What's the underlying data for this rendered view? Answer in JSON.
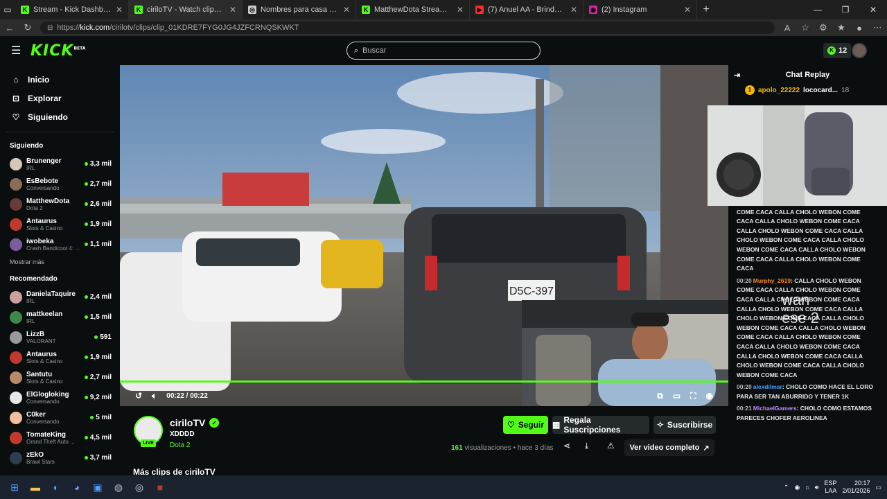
{
  "browser": {
    "tabs": [
      {
        "title": "Stream - Kick Dashboard",
        "favicon_color": "#53fc18",
        "favicon": "K",
        "active": false
      },
      {
        "title": "ciriloTV - Watch clips on Kick",
        "favicon_color": "#53fc18",
        "favicon": "K",
        "active": true
      },
      {
        "title": "Nombres para casa de streamers",
        "favicon_color": "#cfcfcf",
        "favicon": "◎",
        "active": false
      },
      {
        "title": "MatthewDota Stream - Watch Live",
        "favicon_color": "#53fc18",
        "favicon": "K",
        "active": false
      },
      {
        "title": "(7) Anuel AA - Brindemos feat. Oz",
        "favicon_color": "#ff2a2a",
        "favicon": "▶",
        "active": false
      },
      {
        "title": "(2) Instagram",
        "favicon_color": "#d6249f",
        "favicon": "◉",
        "active": false
      }
    ],
    "new_tab": "+",
    "url_domain": "kick.com",
    "url_prefix": "https://",
    "url_path": "/cirilotv/clips/clip_01KDRE7FYG0JG4JZFCRNQSKWKT"
  },
  "header": {
    "logo": "KICK",
    "logo_tag": "BETA",
    "search_placeholder": "Buscar",
    "kicks_count": "12"
  },
  "sidebar": {
    "nav": [
      {
        "label": "Inicio",
        "icon": "home-icon",
        "glyph": "⌂"
      },
      {
        "label": "Explorar",
        "icon": "compass-icon",
        "glyph": "⊡"
      },
      {
        "label": "Siguiendo",
        "icon": "heart-icon",
        "glyph": "♡"
      }
    ],
    "following_title": "Siguiendo",
    "following": [
      {
        "name": "Brunenger",
        "category": "IRL",
        "viewers": "3,3 mil",
        "color": "#d7c7b8"
      },
      {
        "name": "EsBebote",
        "category": "Conversando",
        "viewers": "2,7 mil",
        "color": "#8a6d55"
      },
      {
        "name": "MatthewDota",
        "category": "Dota 2",
        "viewers": "2,6 mil",
        "color": "#6b3b3b"
      },
      {
        "name": "Antaurus",
        "category": "Slots & Casino",
        "viewers": "1,9 mil",
        "color": "#c0392b"
      },
      {
        "name": "iwobeka",
        "category": "Crash Bandicoot 4: ...",
        "viewers": "1,1 mil",
        "color": "#7a5fa0"
      }
    ],
    "show_more": "Mostrar más",
    "recommended_title": "Recomendado",
    "recommended": [
      {
        "name": "DanielaTaquire",
        "category": "IRL",
        "viewers": "2,4 mil",
        "color": "#caa0a0"
      },
      {
        "name": "mattkeelan",
        "category": "IRL",
        "viewers": "1,5 mil",
        "color": "#3c8a4a"
      },
      {
        "name": "LizzB",
        "category": "VALORANT",
        "viewers": "591",
        "color": "#9a9a9a"
      },
      {
        "name": "Antaurus",
        "category": "Slots & Casino",
        "viewers": "1,9 mil",
        "color": "#c0392b"
      },
      {
        "name": "Santutu",
        "category": "Slots & Casino",
        "viewers": "2,7 mil",
        "color": "#b88a6a"
      },
      {
        "name": "ElGlogloking",
        "category": "Conversando",
        "viewers": "9,2 mil",
        "color": "#e8e8e8"
      },
      {
        "name": "C0ker",
        "category": "Conversando",
        "viewers": "5 mil",
        "color": "#f0c0a0"
      },
      {
        "name": "TomateKing",
        "category": "Grand Theft Auto ...",
        "viewers": "4,5 mil",
        "color": "#c0392b"
      },
      {
        "name": "zEkO",
        "category": "Brawl Stars",
        "viewers": "3,7 mil",
        "color": "#2c3e50"
      }
    ]
  },
  "player": {
    "time_current": "00:22",
    "time_sep": "/",
    "time_total": "00:22",
    "progress": 1.0,
    "overlay_line1": "wan",
    "overlay_line2": "ese 2"
  },
  "clip": {
    "channel": "ciriloTV",
    "live": "LIVE",
    "title": "XDDDD",
    "category": "Dota 2",
    "follow": "Seguir",
    "gift": "Regala Suscripciones",
    "subscribe": "Suscribirse",
    "views_count": "161",
    "views_label": "visualizaciones",
    "ago": "• hace 3 días",
    "full_video": "Ver video completo",
    "more_clips": "Más clips de ciriloTV"
  },
  "chat": {
    "title": "Chat Replay",
    "leaderboard": [
      {
        "rank": "1",
        "name": "apolo_22222",
        "other": "lococard...",
        "count": "18"
      }
    ],
    "messages": [
      {
        "time": "",
        "user": "",
        "color": "#ffffff",
        "text": "WEBON COME CACA CALLA CHOLO WEBON COME CACA CALLA CHOLO WEBON COME CACA CALLA CHOLO WEBON COME CACA CALLA CHOLO WEBON COME CACA CALLA CHOLO WEBON COME CACA CALLA CHOLO WEBON COME CACA CALLA CHOLO WEBON COME CACA CALLA CHOLO WEBON COME CACA"
      },
      {
        "time": "00:20",
        "user": "Murphy_2619",
        "color": "#ff8c1a",
        "text": "CALLA CHOLO WEBON COME CACA CALLA CHOLO WEBON COME CACA CALLA CHOLO WEBON COME CACA CALLA CHOLO WEBON COME CACA CALLA CHOLO WEBON COME CACA CALLA CHOLO WEBON COME CACA CALLA CHOLO WEBON COME CACA CALLA CHOLO WEBON COME CACA CALLA CHOLO WEBON COME CACA CALLA CHOLO WEBON COME CACA CALLA CHOLO WEBON COME CACA CALLA CHOLO WEBON COME CACA"
      },
      {
        "time": "00:20",
        "user": "alexdilmar",
        "color": "#4a9cff",
        "text": "CHOLO COMO HACE EL LORO PARA SER TAN ABURRIDO Y TENER 1K"
      },
      {
        "time": "00:21",
        "user": "MichaelGamers",
        "color": "#c58cff",
        "text": "CHOLO COMO ESTAMOS PARECES CHOFER AEROLINEA"
      }
    ]
  },
  "taskbar": {
    "lang_top": "ESP",
    "lang_bottom": "LAA",
    "time": "20:17",
    "date": "2/01/2026"
  },
  "colors": {
    "accent": "#53fc18",
    "bg": "#0b0e0f"
  }
}
